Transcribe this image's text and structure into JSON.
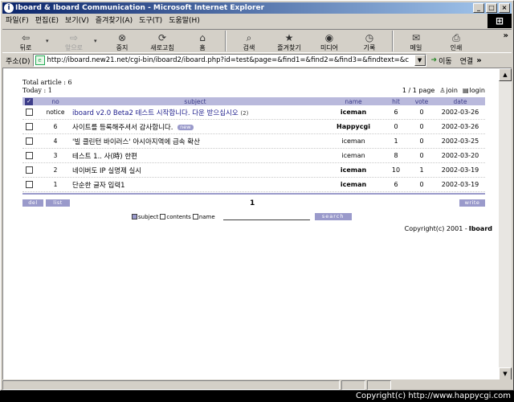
{
  "window": {
    "title": "Iboard & Iboard Communication - Microsoft Internet Explorer",
    "app_icon": "i",
    "controls": [
      "_",
      "□",
      "×"
    ]
  },
  "menu": [
    "파일(F)",
    "편집(E)",
    "보기(V)",
    "즐겨찾기(A)",
    "도구(T)",
    "도움말(H)"
  ],
  "toolbar": [
    {
      "label": "뒤로",
      "icon": "back-arrow-icon",
      "glyph": "⇦",
      "disabled": false,
      "dropdown": true
    },
    {
      "label": "앞으로",
      "icon": "forward-arrow-icon",
      "glyph": "⇨",
      "disabled": true,
      "dropdown": true
    },
    {
      "label": "중지",
      "icon": "stop-icon",
      "glyph": "⊗",
      "disabled": false
    },
    {
      "label": "새로고침",
      "icon": "refresh-icon",
      "glyph": "⟳",
      "disabled": false
    },
    {
      "label": "홈",
      "icon": "home-icon",
      "glyph": "⌂",
      "disabled": false
    },
    {
      "label": "검색",
      "icon": "search-icon",
      "glyph": "⌕",
      "disabled": false
    },
    {
      "label": "즐겨찾기",
      "icon": "favorites-icon",
      "glyph": "★",
      "disabled": false
    },
    {
      "label": "미디어",
      "icon": "media-icon",
      "glyph": "◉",
      "disabled": false
    },
    {
      "label": "기록",
      "icon": "history-icon",
      "glyph": "◷",
      "disabled": false
    },
    {
      "label": "메일",
      "icon": "mail-icon",
      "glyph": "✉",
      "disabled": false,
      "dropdown": true
    },
    {
      "label": "인쇄",
      "icon": "print-icon",
      "glyph": "⎙",
      "disabled": false
    }
  ],
  "address": {
    "label": "주소(D)",
    "url": "http://iboard.new21.net/cgi-bin/iboard2/iboard.php?id=test&page=&find1=&find2=&find3=&findtext=&category=",
    "go_label": "이동",
    "links_label": "연결"
  },
  "board": {
    "total_article": "Total article : 6",
    "today": "Today : 1",
    "page_info": "1 / 1 page",
    "join_label": "join",
    "login_label": "login",
    "headers": {
      "no": "no",
      "subject": "subject",
      "name": "name",
      "hit": "hit",
      "vote": "vote",
      "date": "date"
    },
    "rows": [
      {
        "no": "notice",
        "subject": "iboard v2.0 Beta2 테스트 시작합니다. 다운 받으십시오",
        "reply": "(2)",
        "is_link": true,
        "new": false,
        "name": "iceman",
        "name_bold": true,
        "hit": "6",
        "vote": "0",
        "date": "2002-03-26"
      },
      {
        "no": "6",
        "subject": "사이트를 등록해주셔서 감사합니다.",
        "reply": "",
        "is_link": false,
        "new": true,
        "new_label": "new",
        "name": "Happycgi",
        "name_bold": true,
        "hit": "0",
        "vote": "0",
        "date": "2002-03-26"
      },
      {
        "no": "4",
        "subject": "'빌 클린턴 바이러스' 아시아지역에 급속 확산",
        "reply": "",
        "is_link": false,
        "new": false,
        "name": "iceman",
        "name_bold": false,
        "hit": "1",
        "vote": "0",
        "date": "2002-03-25"
      },
      {
        "no": "3",
        "subject": "테스트 1.. 사(時) 한편",
        "reply": "",
        "is_link": false,
        "new": false,
        "name": "iceman",
        "name_bold": false,
        "hit": "8",
        "vote": "0",
        "date": "2002-03-20"
      },
      {
        "no": "2",
        "subject": "네이버도 IP 실명제 실시",
        "reply": "",
        "is_link": false,
        "new": false,
        "name": "iceman",
        "name_bold": true,
        "hit": "10",
        "vote": "1",
        "date": "2002-03-19"
      },
      {
        "no": "1",
        "subject": "단순한 글자 입력1",
        "reply": "",
        "is_link": false,
        "new": false,
        "name": "iceman",
        "name_bold": true,
        "hit": "6",
        "vote": "0",
        "date": "2002-03-19"
      }
    ],
    "buttons": {
      "del": "del",
      "list": "list",
      "write": "write"
    },
    "pager": "1",
    "search": {
      "options": [
        {
          "label": "subject",
          "checked": true
        },
        {
          "label": "contents",
          "checked": false
        },
        {
          "label": "name",
          "checked": false
        }
      ],
      "value": "",
      "button": "search"
    },
    "copyright": "Copyright(c) 2001 -",
    "copyright_logo": "Iboard"
  },
  "overlay_caption": "Copyright(c) http://www.happycgi.com",
  "colors": {
    "accent": "#9a9acb",
    "header_band": "#b9b9dc",
    "title_start": "#0a246a",
    "title_end": "#a6caf0",
    "link": "#1a1a8a"
  }
}
